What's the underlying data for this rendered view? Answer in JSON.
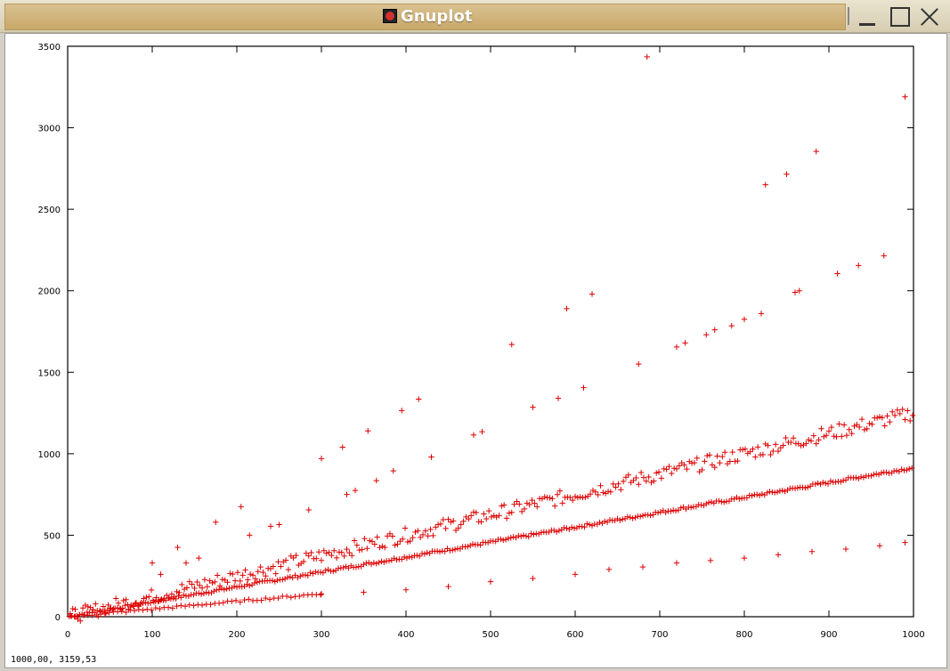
{
  "window": {
    "title": "Gnuplot",
    "icon": "gnuplot-icon"
  },
  "status": {
    "coords": "1000,00,  3159,53"
  },
  "colors": {
    "points": "#dd0000",
    "axis": "#000000"
  },
  "chart_data": {
    "type": "scatter",
    "marker": "plus",
    "xlim": [
      0,
      1000
    ],
    "ylim": [
      0,
      3500
    ],
    "xticks": [
      "0",
      "100",
      "200",
      "300",
      "400",
      "500",
      "600",
      "700",
      "800",
      "900",
      "1000"
    ],
    "yticks": [
      "0",
      "500",
      "1000",
      "1500",
      "2000",
      "2500",
      "3000",
      "3500"
    ],
    "grid": false,
    "series": [
      {
        "values": [
          [
            100,
            330
          ],
          [
            110,
            260
          ],
          [
            130,
            425
          ],
          [
            140,
            330
          ],
          [
            155,
            360
          ],
          [
            175,
            580
          ],
          [
            205,
            675
          ],
          [
            215,
            500
          ],
          [
            240,
            555
          ],
          [
            250,
            565
          ],
          [
            285,
            655
          ],
          [
            300,
            970
          ],
          [
            325,
            1040
          ],
          [
            330,
            750
          ],
          [
            340,
            775
          ],
          [
            355,
            1140
          ],
          [
            365,
            835
          ],
          [
            385,
            895
          ],
          [
            395,
            1265
          ],
          [
            415,
            1335
          ],
          [
            430,
            980
          ],
          [
            480,
            1115
          ],
          [
            490,
            1135
          ],
          [
            525,
            1670
          ],
          [
            550,
            1285
          ],
          [
            580,
            1340
          ],
          [
            590,
            1890
          ],
          [
            610,
            1405
          ],
          [
            620,
            1980
          ],
          [
            675,
            1550
          ],
          [
            685,
            3435
          ],
          [
            720,
            1655
          ],
          [
            730,
            1680
          ],
          [
            755,
            1730
          ],
          [
            765,
            1760
          ],
          [
            785,
            1785
          ],
          [
            800,
            1825
          ],
          [
            820,
            1860
          ],
          [
            825,
            2650
          ],
          [
            850,
            2715
          ],
          [
            860,
            1990
          ],
          [
            865,
            2000
          ],
          [
            885,
            2855
          ],
          [
            910,
            2105
          ],
          [
            935,
            2155
          ],
          [
            965,
            2215
          ],
          [
            990,
            3190
          ],
          [
            300,
            140
          ],
          [
            350,
            150
          ],
          [
            400,
            165
          ],
          [
            450,
            185
          ],
          [
            500,
            215
          ],
          [
            550,
            235
          ],
          [
            600,
            260
          ],
          [
            640,
            290
          ],
          [
            680,
            305
          ],
          [
            720,
            330
          ],
          [
            760,
            345
          ],
          [
            800,
            360
          ],
          [
            840,
            380
          ],
          [
            880,
            400
          ],
          [
            920,
            415
          ],
          [
            960,
            435
          ],
          [
            990,
            455
          ]
        ]
      }
    ]
  }
}
